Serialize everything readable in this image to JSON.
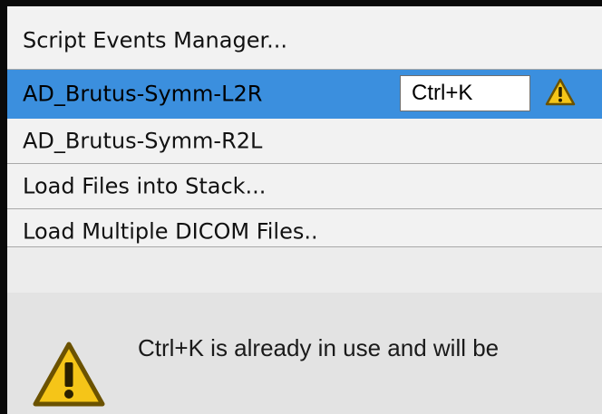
{
  "menu": {
    "items": [
      {
        "label": "Script Events Manager..."
      },
      {
        "label": "AD_Brutus-Symm-L2R",
        "shortcut": "Ctrl+K",
        "selected": true
      },
      {
        "label": "AD_Brutus-Symm-R2L"
      },
      {
        "label": "Load Files into Stack..."
      },
      {
        "label": "Load Multiple DICOM Files.."
      }
    ]
  },
  "message": {
    "text": "Ctrl+K is already in use and will be"
  },
  "colors": {
    "selection": "#3b8fde",
    "warning_fill": "#f5c518",
    "warning_outline": "#6b5200"
  },
  "icons": {
    "row_warning": "warning-icon",
    "dialog_warning": "warning-icon"
  }
}
